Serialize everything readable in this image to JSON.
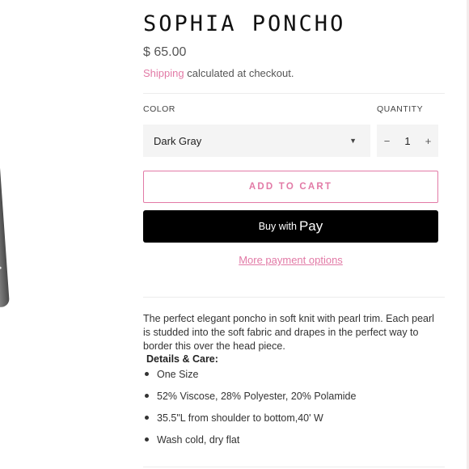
{
  "product": {
    "title": "SOPHIA PONCHO",
    "price": "$ 65.00",
    "shipping_link": "Shipping",
    "shipping_text": " calculated at checkout."
  },
  "options": {
    "color_label": "COLOR",
    "color_selected": "Dark Gray",
    "quantity_label": "QUANTITY",
    "quantity_value": "1",
    "minus": "−",
    "plus": "+"
  },
  "actions": {
    "add_to_cart": "ADD TO CART",
    "buy_with": "Buy with",
    "pay_word": "Pay",
    "more_payment": "More payment options"
  },
  "description": {
    "text": "The perfect elegant poncho in soft knit with pearl trim. Each pearl is studded into the soft fabric and drapes in the perfect way to border this over the head piece.",
    "details_heading": "Details & Care:",
    "bullets": [
      "One Size",
      "52% Viscose, 28% Polyester, 20% Polamide",
      "35.5\"L from shoulder to bottom,40' W",
      "Wash cold, dry flat"
    ]
  },
  "icons": {
    "dropdown": "caret-down-icon",
    "apple": "apple-logo-icon"
  },
  "colors": {
    "accent": "#e27aa6",
    "apple_pay_bg": "#000000"
  }
}
